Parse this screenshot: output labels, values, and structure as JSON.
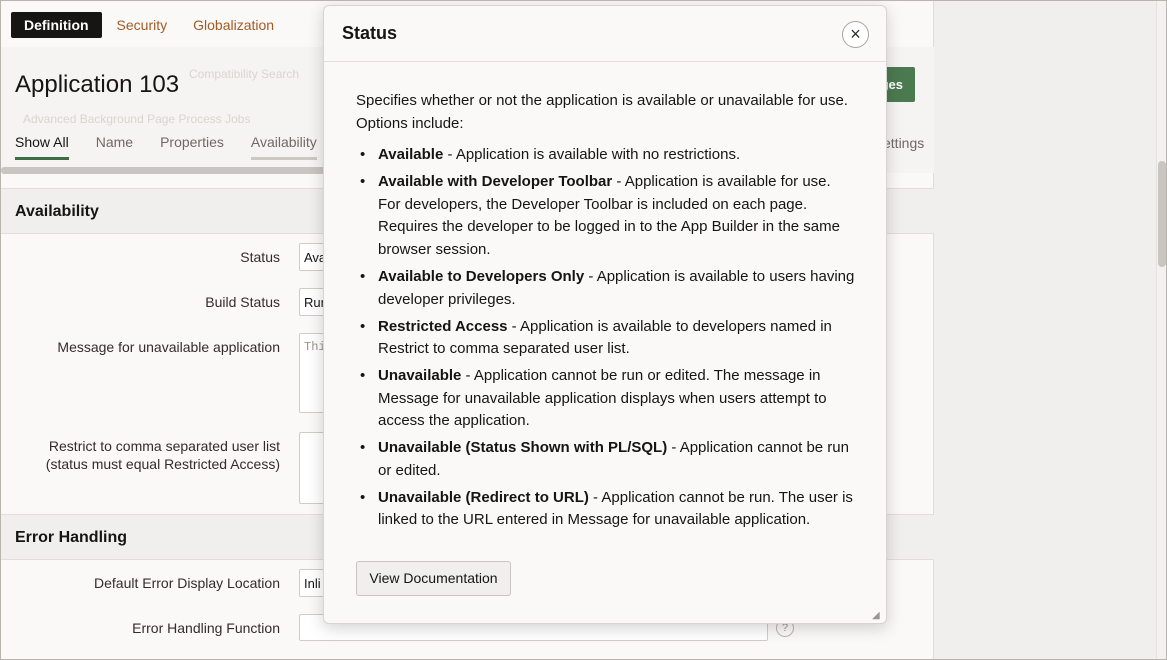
{
  "top_tabs": [
    "Definition",
    "Security",
    "Globalization"
  ],
  "header": {
    "title": "Application 103",
    "ghost_text_1": "Compatibility Search",
    "ghost_text_2": "Advanced Background Page Process Jobs",
    "apply_button": "Apply Changes",
    "apply_visible": "ges",
    "sub_tabs": [
      "Show All",
      "Name",
      "Properties",
      "Availability"
    ],
    "settings_tail": "ettings"
  },
  "availability": {
    "heading": "Availability",
    "status_label": "Status",
    "status_value": "Ava",
    "build_status_label": "Build Status",
    "build_status_value": "Run",
    "message_label": "Message for unavailable application",
    "message_placeholder": "Thi",
    "restrict_label_1": "Restrict to comma separated user list",
    "restrict_label_2": "(status must equal Restricted Access)"
  },
  "error_handling": {
    "heading": "Error Handling",
    "display_location_label": "Default Error Display Location",
    "display_location_value": "Inli",
    "function_label": "Error Handling Function",
    "help_glyph": "?"
  },
  "modal": {
    "title": "Status",
    "close_glyph": "×",
    "intro": "Specifies whether or not the application is available or unavailable for use. Options include:",
    "options": [
      {
        "name": "Available",
        "desc": " - Application is available with no restrictions."
      },
      {
        "name": "Available with Developer Toolbar",
        "desc": " - Application is available for use. For developers, the Developer Toolbar is included on each page. Requires the developer to be logged in to the App Builder in the same browser session."
      },
      {
        "name": "Available to Developers Only",
        "desc": " - Application is available to users having developer privileges."
      },
      {
        "name": "Restricted Access",
        "desc": " - Application is available to developers named in Restrict to comma separated user list."
      },
      {
        "name": "Unavailable",
        "desc": " - Application cannot be run or edited. The message in Message for unavailable application displays when users attempt to access the application."
      },
      {
        "name": "Unavailable (Status Shown with PL/SQL)",
        "desc": " - Application cannot be run or edited."
      },
      {
        "name": "Unavailable (Redirect to URL)",
        "desc": " - Application cannot be run. The user is linked to the URL entered in Message for unavailable application."
      }
    ],
    "doc_button": "View Documentation"
  },
  "colors": {
    "accent_green": "#4b7a50",
    "tab_link": "#a45a22",
    "active_tab_bg": "#161513"
  }
}
